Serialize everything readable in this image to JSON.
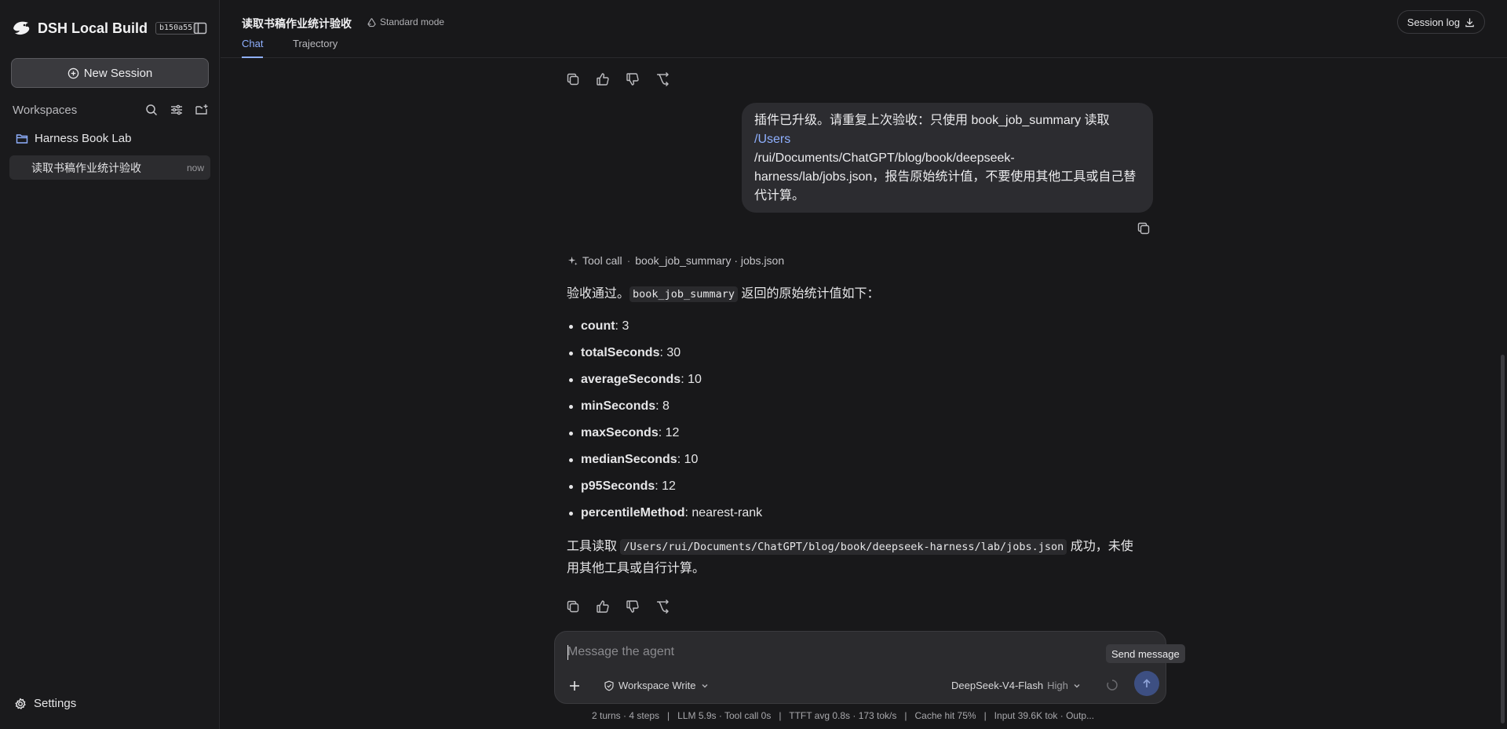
{
  "app": {
    "title": "DSH Local Build",
    "build": "b150a55"
  },
  "sidebar": {
    "new_session_label": "New Session",
    "workspaces_label": "Workspaces",
    "folder_name": "Harness Book Lab",
    "sessions": [
      {
        "title": "读取书稿作业统计验收",
        "time": "now"
      }
    ],
    "settings_label": "Settings"
  },
  "header": {
    "session_title": "读取书稿作业统计验收",
    "mode": "Standard mode",
    "tabs": [
      "Chat",
      "Trajectory"
    ],
    "active_tab": "Chat",
    "session_log_label": "Session log"
  },
  "chat": {
    "user_message": {
      "line1": "插件已升级。请重复上次验收：只使用 book_job_summary 读取",
      "path_link": "/Users",
      "line3": "/rui/Documents/ChatGPT/blog/book/deepseek-",
      "line4": "harness/lab/jobs.json，报告原始统计值，不要使用其他工具或自己替",
      "line5": "代计算。"
    },
    "tool_call": {
      "label": "Tool call",
      "separator": "·",
      "detail": "book_job_summary · jobs.json"
    },
    "answer": {
      "intro_before": "验收通过。",
      "intro_code": "book_job_summary",
      "intro_after": "返回的原始统计值如下：",
      "stats": [
        {
          "key": "count",
          "value": ": 3"
        },
        {
          "key": "totalSeconds",
          "value": ": 30"
        },
        {
          "key": "averageSeconds",
          "value": ": 10"
        },
        {
          "key": "minSeconds",
          "value": ": 8"
        },
        {
          "key": "maxSeconds",
          "value": ": 12"
        },
        {
          "key": "medianSeconds",
          "value": ": 10"
        },
        {
          "key": "p95Seconds",
          "value": ": 12"
        },
        {
          "key": "percentileMethod",
          "value": ": nearest-rank"
        }
      ],
      "closing_before": "工具读取",
      "closing_code": "/Users/rui/Documents/ChatGPT/blog/book/deepseek-harness/lab/jobs.json",
      "closing_after": "成功，未使",
      "closing_line2": "用其他工具或自行计算。"
    }
  },
  "composer": {
    "placeholder": "Message the agent",
    "permission": "Workspace Write",
    "model": "DeepSeek-V4-Flash",
    "level": "High",
    "send_tooltip": "Send message"
  },
  "status_bar": "2 turns · 4 steps   |   LLM 5.9s · Tool call 0s   |   TTFT avg 0.8s · 173 tok/s   |   Cache hit 75%   |   Input 39.6K tok · Outp...",
  "colors": {
    "accent": "#8fb0ff",
    "background": "#18181a",
    "sidebar": "#1a1a1c",
    "send_button": "#3d4f82"
  },
  "icons": [
    "logo-icon",
    "sidebar-toggle-icon",
    "plus-circle-icon",
    "search-icon",
    "filter-icon",
    "new-folder-icon",
    "folder-icon",
    "gear-icon",
    "recycle-icon",
    "download-icon",
    "copy-icon",
    "thumbs-up-icon",
    "thumbs-down-icon",
    "branch-icon",
    "sparkle-icon",
    "plus-icon",
    "shield-icon",
    "chevron-down-icon",
    "spinner-icon",
    "arrow-up-icon"
  ]
}
